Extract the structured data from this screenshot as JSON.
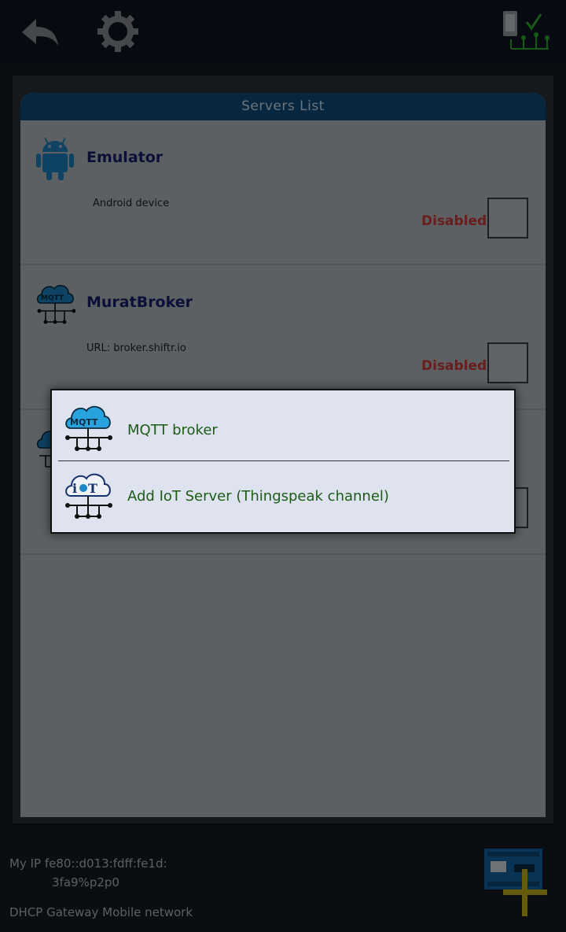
{
  "toolbar": {
    "back_icon": "back-arrow-icon",
    "settings_icon": "gear-icon",
    "status_icon": "device-network-ok-icon"
  },
  "servers_list": {
    "title": "Servers List",
    "items": [
      {
        "name": "Emulator",
        "description": "Android device",
        "status": "Disabled",
        "icon": "android-icon"
      },
      {
        "name": "MuratBroker",
        "description": "URL:  broker.shiftr.io",
        "status": "Disabled",
        "icon": "mqtt-cloud-icon"
      },
      {
        "name": "",
        "description": "",
        "status": "",
        "icon": "mqtt-cloud-icon"
      }
    ]
  },
  "menu": {
    "items": [
      {
        "label": "MQTT broker",
        "icon": "mqtt-cloud-icon"
      },
      {
        "label": "Add IoT Server (Thingspeak channel)",
        "icon": "iot-cloud-icon"
      }
    ]
  },
  "footer": {
    "ip_line1": "My IP fe80::d013:fdff:fe1d:",
    "ip_line2": "3fa9%p2p0",
    "network": "DHCP Gateway Mobile network",
    "add_icon": "add-board-icon"
  },
  "colors": {
    "header": "#0e4f82",
    "name": "#17216e",
    "disabled": "#d23b3b",
    "menu_text": "#1c5c16"
  }
}
